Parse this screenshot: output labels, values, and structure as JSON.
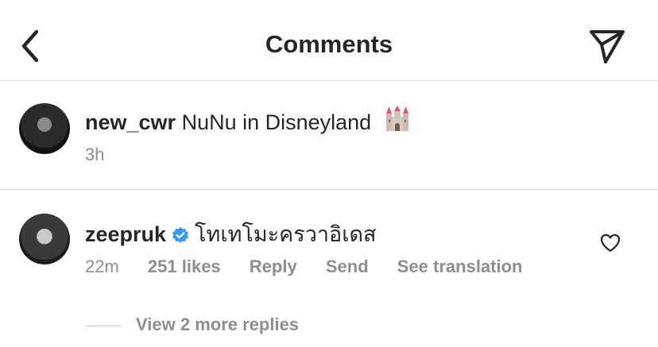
{
  "header": {
    "title": "Comments",
    "back_icon": "chevron-left-icon",
    "share_icon": "paper-plane-icon"
  },
  "caption": {
    "username": "new_cwr",
    "text": "NuNu in Disneyland",
    "emoji": "castle-emoji",
    "time": "3h"
  },
  "comments": [
    {
      "username": "zeepruk",
      "verified": true,
      "text": "โทเทโมะครวาอิเดส",
      "time": "22m",
      "likes": "251 likes",
      "reply_label": "Reply",
      "send_label": "Send",
      "translate_label": "See translation",
      "view_replies": "View 2 more replies"
    }
  ],
  "colors": {
    "text": "#262626",
    "secondary": "#8e8e8e",
    "divider": "#dbdbdb",
    "verified": "#3897f0"
  }
}
